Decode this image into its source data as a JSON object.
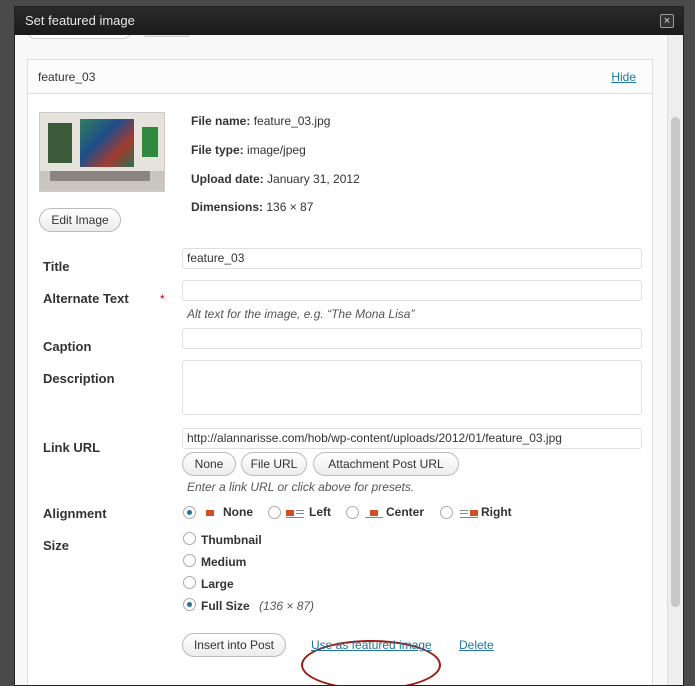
{
  "dialog": {
    "title": "Set featured image",
    "close_glyph": "×"
  },
  "item": {
    "name": "feature_03",
    "hide_label": "Hide"
  },
  "meta": [
    {
      "label": "File name:",
      "value": "feature_03.jpg"
    },
    {
      "label": "File type:",
      "value": "image/jpeg"
    },
    {
      "label": "Upload date:",
      "value": "January 31, 2012"
    },
    {
      "label": "Dimensions:",
      "value": "136 × 87"
    }
  ],
  "edit_image_label": "Edit Image",
  "fields": {
    "title": {
      "label": "Title",
      "required_mark": "*",
      "value": "feature_03"
    },
    "alt": {
      "label": "Alternate Text",
      "value": "",
      "help": "Alt text for the image, e.g. “The Mona Lisa”"
    },
    "caption": {
      "label": "Caption",
      "value": ""
    },
    "description": {
      "label": "Description",
      "value": ""
    },
    "link": {
      "label": "Link URL",
      "value": "http://alannarisse.com/hob/wp-content/uploads/2012/01/feature_03.jpg",
      "buttons": [
        "None",
        "File URL",
        "Attachment Post URL"
      ],
      "help": "Enter a link URL or click above for presets."
    }
  },
  "alignment": {
    "label": "Alignment",
    "options": [
      "None",
      "Left",
      "Center",
      "Right"
    ],
    "selected": "None"
  },
  "size": {
    "label": "Size",
    "options": [
      "Thumbnail",
      "Medium",
      "Large",
      "Full Size"
    ],
    "selected": "Full Size",
    "full_dims": "(136 × 87)"
  },
  "actions": {
    "insert_label": "Insert into Post",
    "featured_label": "Use as featured image",
    "delete_label": "Delete"
  },
  "colors": {
    "link": "#21759b",
    "titlebar": "#222222",
    "annotation": "#9b1c10"
  }
}
